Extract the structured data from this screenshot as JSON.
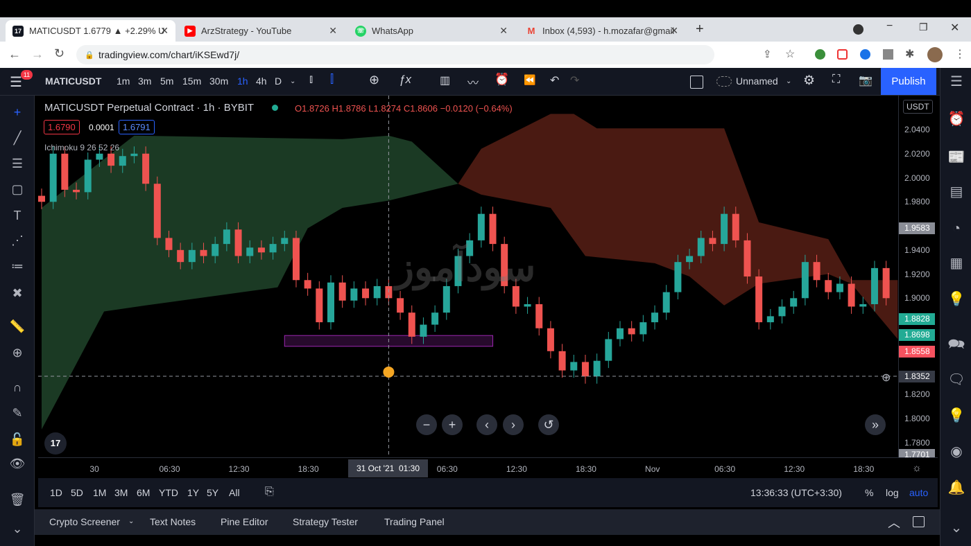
{
  "browser": {
    "tabs": [
      {
        "title": "MATICUSDT 1.6779 ▲ +2.29% U",
        "icon": "tradingview-icon",
        "active": true
      },
      {
        "title": "ArzStrategy - YouTube",
        "icon": "youtube-icon"
      },
      {
        "title": "WhatsApp",
        "icon": "whatsapp-icon"
      },
      {
        "title": "Inbox (4,593) - h.mozafar@gmail",
        "icon": "gmail-icon"
      }
    ],
    "url": "tradingview.com/chart/iKSEwd7j/"
  },
  "toolbar": {
    "menu_badge": "11",
    "symbol": "MATICUSDT",
    "intervals": [
      "1m",
      "3m",
      "5m",
      "15m",
      "30m",
      "1h",
      "4h",
      "D"
    ],
    "active_interval": "1h",
    "layout_name": "Unnamed",
    "publish": "Publish"
  },
  "legend": {
    "title": "MATICUSDT Perpetual Contract · 1h · BYBIT",
    "ohlc": "O1.8726 H1.8786 L1.8274 C1.8606 −0.0120 (−0.64%)",
    "bid": "1.6790",
    "spread": "0.0001",
    "ask": "1.6791",
    "indicator": "Ichimoku 9 26 52 26"
  },
  "watermark": "سودآموز",
  "price_axis": {
    "currency": "USDT",
    "ticks": [
      "2.0400",
      "2.0200",
      "2.0000",
      "1.9800",
      "1.9400",
      "1.9200",
      "1.9000",
      "1.8200",
      "1.8000",
      "1.7800"
    ],
    "tick_values": [
      2.04,
      2.02,
      2.0,
      1.98,
      1.94,
      1.92,
      1.9,
      1.82,
      1.8,
      1.78
    ],
    "badges": [
      {
        "label": "1.9583",
        "value": 1.9583,
        "color": "#8a8d96"
      },
      {
        "label": "1.8828",
        "value": 1.8828,
        "color": "#22ab94"
      },
      {
        "label": "1.8698",
        "value": 1.8698,
        "color": "#22ab94"
      },
      {
        "label": "1.8558",
        "value": 1.8558,
        "color": "#f7525f"
      },
      {
        "label": "1.8352",
        "value": 1.8352,
        "color": "#363a45"
      },
      {
        "label": "1.7701",
        "value": 1.7701,
        "color": "#8a8d96"
      }
    ]
  },
  "time_axis": {
    "ticks": [
      {
        "label": "30",
        "i": 5
      },
      {
        "label": "06:30",
        "i": 11
      },
      {
        "label": "12:30",
        "i": 17
      },
      {
        "label": "18:30",
        "i": 23
      },
      {
        "label": "06:30",
        "i": 35
      },
      {
        "label": "12:30",
        "i": 41
      },
      {
        "label": "18:30",
        "i": 47
      },
      {
        "label": "Nov",
        "i": 53
      },
      {
        "label": "06:30",
        "i": 59
      },
      {
        "label": "12:30",
        "i": 65
      },
      {
        "label": "18:30",
        "i": 71
      }
    ],
    "crosshair_label": "31 Oct '21  01:30"
  },
  "chart_data": {
    "type": "candlestick",
    "ylim": [
      1.77,
      2.05
    ],
    "colors": {
      "up": "#26a69a",
      "down": "#ef5350",
      "cloud_up": "#1b3a24",
      "cloud_down": "#4a1a12"
    },
    "first_open": 1.985,
    "close": [
      1.98,
      2.02,
      1.99,
      1.988,
      2.015,
      2.02,
      2.01,
      2.018,
      2.02,
      1.995,
      1.95,
      1.94,
      1.93,
      1.94,
      1.935,
      1.945,
      1.957,
      1.935,
      1.942,
      1.938,
      1.945,
      1.95,
      1.915,
      1.908,
      1.88,
      1.913,
      1.898,
      1.908,
      1.9,
      1.91,
      1.9,
      1.888,
      1.868,
      1.878,
      1.888,
      1.91,
      1.935,
      1.948,
      1.97,
      1.945,
      1.91,
      1.893,
      1.895,
      1.875,
      1.856,
      1.84,
      1.847,
      1.835,
      1.848,
      1.866,
      1.875,
      1.87,
      1.88,
      1.888,
      1.905,
      1.93,
      1.935,
      1.95,
      1.945,
      1.97,
      1.948,
      1.918,
      1.88,
      1.885,
      1.893,
      1.9,
      1.93,
      1.915,
      1.905,
      1.912,
      1.893,
      1.895,
      1.925,
      1.9
    ],
    "cloud_green": {
      "top": [
        [
          0,
          1.975
        ],
        [
          8,
          2.035
        ],
        [
          26,
          2.032
        ],
        [
          30,
          2.035
        ],
        [
          32,
          2.03
        ],
        [
          36,
          1.995
        ]
      ],
      "bottom": [
        [
          0,
          1.791
        ],
        [
          5.4,
          1.889
        ],
        [
          9,
          1.894
        ],
        [
          20.4,
          1.909
        ],
        [
          23,
          1.958
        ],
        [
          26,
          1.975
        ],
        [
          30,
          1.981
        ],
        [
          36,
          1.995
        ]
      ]
    },
    "cloud_red": {
      "top": [
        [
          36,
          1.995
        ],
        [
          38,
          2.024
        ],
        [
          44,
          2.053
        ],
        [
          46,
          2.053
        ],
        [
          48,
          2.041
        ],
        [
          59,
          2.041
        ],
        [
          62,
          1.963
        ],
        [
          68,
          1.949
        ],
        [
          70,
          1.915
        ],
        [
          74,
          1.915
        ]
      ],
      "bottom": [
        [
          36,
          1.995
        ],
        [
          38,
          1.986
        ],
        [
          44,
          1.975
        ],
        [
          47,
          1.935
        ],
        [
          53,
          1.929
        ],
        [
          56,
          1.918
        ],
        [
          59,
          1.894
        ],
        [
          62,
          1.912
        ],
        [
          68,
          1.92
        ],
        [
          70,
          1.912
        ],
        [
          74,
          1.866
        ]
      ]
    },
    "zone": {
      "from_i": 21,
      "to_i": 39,
      "top": 1.869,
      "bottom": 1.86,
      "color": "#9c27b0"
    },
    "crosshair": {
      "i": 30,
      "price": 1.8352
    }
  },
  "range": {
    "buttons": [
      "1D",
      "5D",
      "1M",
      "3M",
      "6M",
      "YTD",
      "1Y",
      "5Y",
      "All"
    ],
    "clock": "13:36:33 (UTC+3:30)",
    "percent": "%",
    "log": "log",
    "auto": "auto"
  },
  "bottom_tabs": [
    "Crypto Screener",
    "Text Notes",
    "Pine Editor",
    "Strategy Tester",
    "Trading Panel"
  ]
}
